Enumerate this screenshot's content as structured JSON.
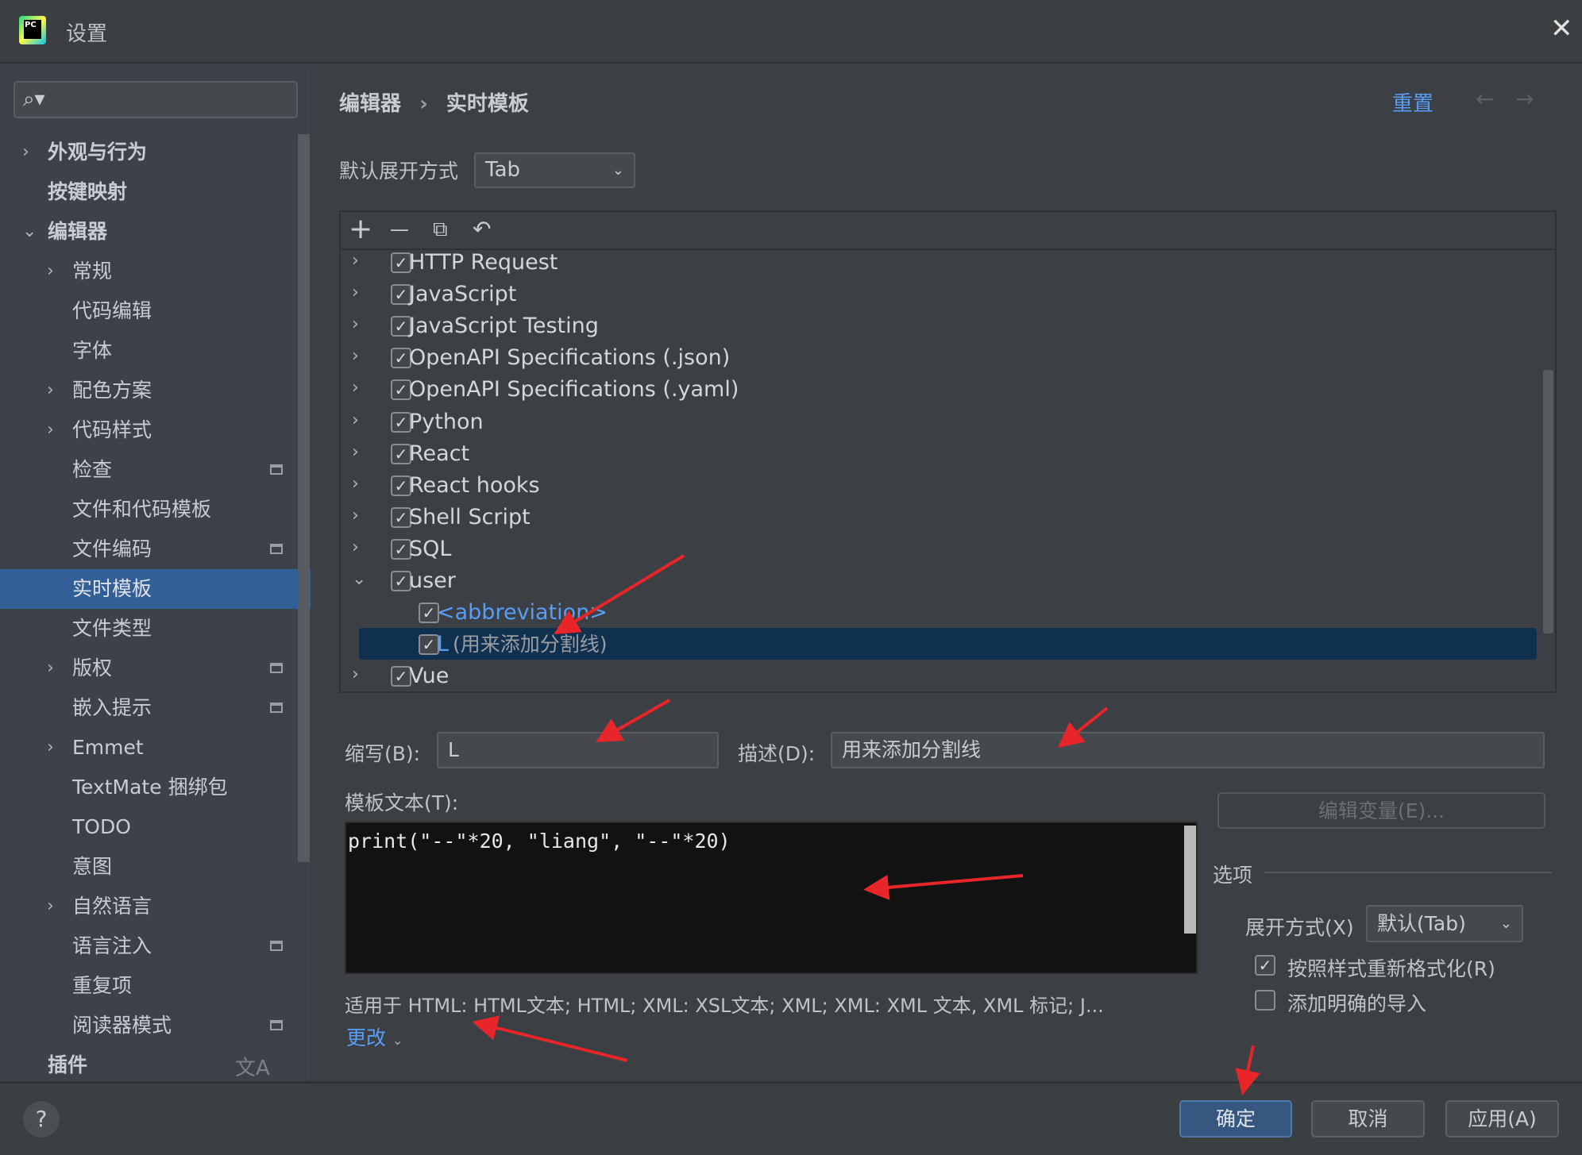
{
  "window": {
    "title": "设置",
    "logo_text": "PC"
  },
  "sidebar": {
    "items": [
      {
        "label": "外观与行为",
        "chev": "›"
      },
      {
        "label": "按键映射",
        "chev": ""
      },
      {
        "label": "编辑器",
        "chev": "⌄"
      },
      {
        "label": "常规",
        "chev": "›"
      },
      {
        "label": "代码编辑",
        "chev": ""
      },
      {
        "label": "字体",
        "chev": ""
      },
      {
        "label": "配色方案",
        "chev": "›"
      },
      {
        "label": "代码样式",
        "chev": "›"
      },
      {
        "label": "检查",
        "chev": ""
      },
      {
        "label": "文件和代码模板",
        "chev": ""
      },
      {
        "label": "文件编码",
        "chev": ""
      },
      {
        "label": "实时模板",
        "chev": ""
      },
      {
        "label": "文件类型",
        "chev": ""
      },
      {
        "label": "版权",
        "chev": "›"
      },
      {
        "label": "嵌入提示",
        "chev": ""
      },
      {
        "label": "Emmet",
        "chev": "›"
      },
      {
        "label": "TextMate 捆绑包",
        "chev": ""
      },
      {
        "label": "TODO",
        "chev": ""
      },
      {
        "label": "意图",
        "chev": ""
      },
      {
        "label": "自然语言",
        "chev": "›"
      },
      {
        "label": "语言注入",
        "chev": ""
      },
      {
        "label": "重复项",
        "chev": ""
      },
      {
        "label": "阅读器模式",
        "chev": ""
      },
      {
        "label": "插件",
        "chev": ""
      }
    ],
    "selected": "实时模板"
  },
  "header": {
    "breadcrumb": [
      "编辑器",
      "实时模板"
    ],
    "separator": "›",
    "reset": "重置",
    "back": "←",
    "forward": "→"
  },
  "expand_default": {
    "label": "默认展开方式",
    "value": "Tab"
  },
  "toolbar": {
    "add": "+",
    "remove": "—",
    "copy": "⧉",
    "undo": "↶"
  },
  "tree": [
    {
      "label": "HTTP Request",
      "checked": true,
      "expanded": false
    },
    {
      "label": "JavaScript",
      "checked": true,
      "expanded": false
    },
    {
      "label": "JavaScript Testing",
      "checked": true,
      "expanded": false
    },
    {
      "label": "OpenAPI Specifications (.json)",
      "checked": true,
      "expanded": false
    },
    {
      "label": "OpenAPI Specifications (.yaml)",
      "checked": true,
      "expanded": false
    },
    {
      "label": "Python",
      "checked": true,
      "expanded": false
    },
    {
      "label": "React",
      "checked": true,
      "expanded": false
    },
    {
      "label": "React hooks",
      "checked": true,
      "expanded": false
    },
    {
      "label": "Shell Script",
      "checked": true,
      "expanded": false
    },
    {
      "label": "SQL",
      "checked": true,
      "expanded": false
    },
    {
      "label": "user",
      "checked": true,
      "expanded": true
    },
    {
      "label": "<abbreviation>",
      "checked": true,
      "child": true
    },
    {
      "label": "L",
      "desc": "(用来添加分割线)",
      "checked": true,
      "child": true,
      "selected": true
    },
    {
      "label": "Vue",
      "checked": true,
      "expanded": false
    }
  ],
  "editor": {
    "abbr_label": "缩写(B):",
    "abbr_value": "L",
    "desc_label": "描述(D):",
    "desc_value": "用来添加分割线",
    "text_label": "模板文本(T):",
    "text_value": "print(\"--\"*20, \"liang\", \"--\"*20)",
    "edit_vars": "编辑变量(E)...",
    "applies": "适用于 HTML: HTML文本; HTML; XML: XSL文本; XML; XML: XML 文本, XML 标记; J...",
    "change": "更改"
  },
  "options": {
    "title": "选项",
    "expand_label": "展开方式(X)",
    "expand_value": "默认(Tab)",
    "reformat": {
      "label": "按照样式重新格式化(R)",
      "checked": true
    },
    "imports": {
      "label": "添加明确的导入",
      "checked": false
    }
  },
  "footer": {
    "help": "?",
    "ok": "确定",
    "cancel": "取消",
    "apply": "应用(A)"
  },
  "colors": {
    "accent": "#335f97",
    "link": "#589df6",
    "annotation": "#e8262a"
  }
}
